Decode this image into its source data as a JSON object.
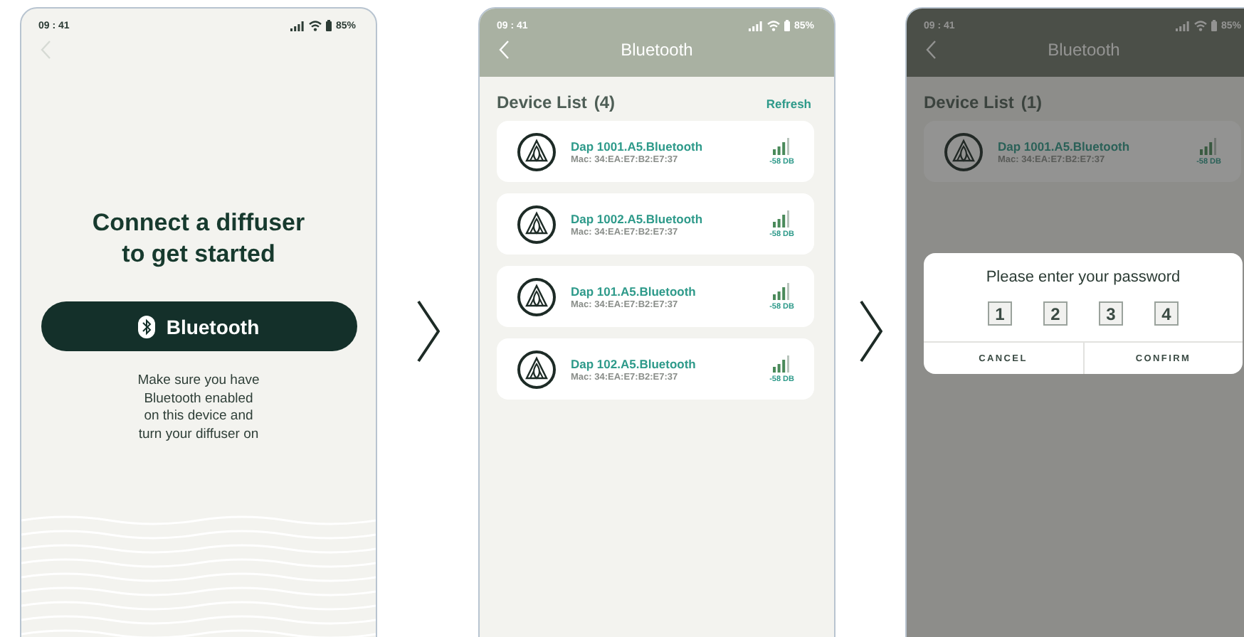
{
  "screens": [
    {
      "kind": "connect",
      "status_bar": {
        "time": "09 : 41",
        "battery": "85%"
      },
      "heading": "Connect a diffuser to get started",
      "button": "Bluetooth",
      "hint_lines": [
        "Make sure you have",
        "Bluetooth enabled",
        "on this device and",
        "turn your diffuser on"
      ]
    },
    {
      "kind": "device_list",
      "status_bar": {
        "time": "09 : 41",
        "battery": "85%"
      },
      "title": "Bluetooth",
      "list_title": "Device List",
      "count": "(4)",
      "refresh": "Refresh",
      "devices": [
        {
          "name": "Dap 1001.A5.Bluetooth",
          "mac": "Mac: 34:EA:E7:B2:E7:37",
          "rssi": "-58 DB"
        },
        {
          "name": "Dap 1002.A5.Bluetooth",
          "mac": "Mac: 34:EA:E7:B2:E7:37",
          "rssi": "-58 DB"
        },
        {
          "name": "Dap 101.A5.Bluetooth",
          "mac": "Mac: 34:EA:E7:B2:E7:37",
          "rssi": "-58 DB"
        },
        {
          "name": "Dap 102.A5.Bluetooth",
          "mac": "Mac: 34:EA:E7:B2:E7:37",
          "rssi": "-58 DB"
        }
      ]
    },
    {
      "kind": "device_list",
      "status_bar": {
        "time": "09 : 41",
        "battery": "85%"
      },
      "title": "Bluetooth",
      "list_title": "Device List",
      "count": "(1)",
      "devices": [
        {
          "name": "Dap 1001.A5.Bluetooth",
          "mac": "Mac: 34:EA:E7:B2:E7:37",
          "rssi": "-58 DB"
        }
      ],
      "dialog": {
        "title": "Please enter your password",
        "digits": [
          "1",
          "2",
          "3",
          "4"
        ],
        "buttons": [
          "CANCEL",
          "CONFIRM"
        ]
      }
    }
  ]
}
